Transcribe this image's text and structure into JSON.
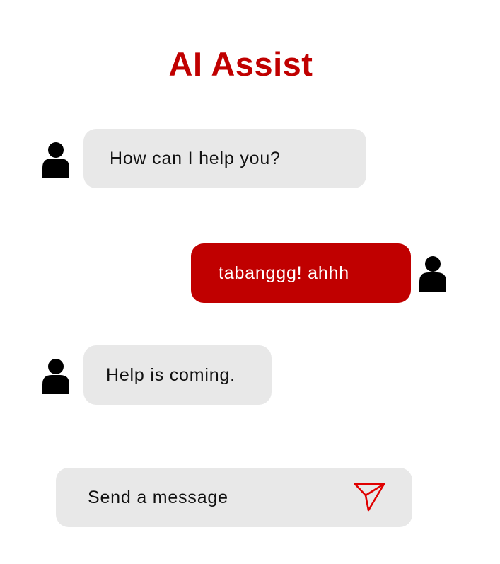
{
  "app": {
    "title": "AI Assist"
  },
  "colors": {
    "accent": "#c00000",
    "bubble_assistant": "#e8e8e8",
    "input_background": "#e8e8e8"
  },
  "messages": [
    {
      "sender": "assistant",
      "text": "How can I help you?",
      "icon": "person-icon"
    },
    {
      "sender": "user",
      "text": "tabanggg! ahhh",
      "icon": "person-icon"
    },
    {
      "sender": "assistant",
      "text": "Help is coming.",
      "icon": "person-icon"
    }
  ],
  "composer": {
    "placeholder": "Send a message",
    "send_icon": "send-icon"
  }
}
